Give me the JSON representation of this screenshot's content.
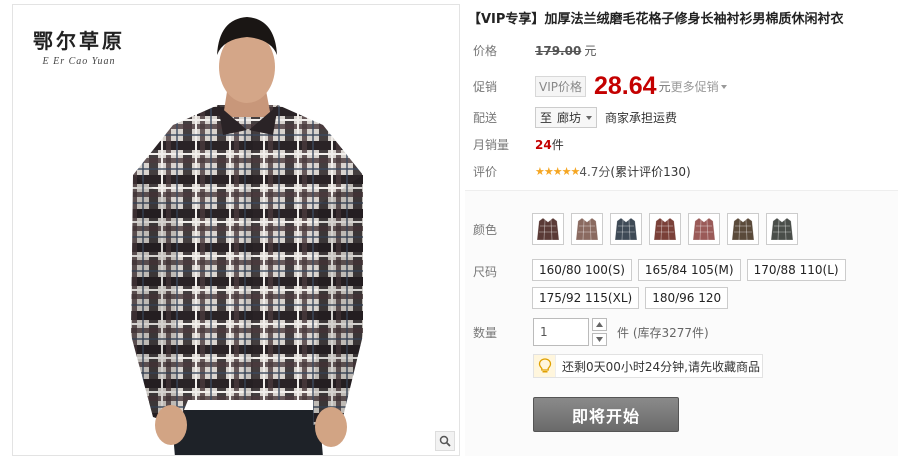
{
  "brand": {
    "name_cn": "鄂尔草原",
    "name_en": "E Er Cao Yuan"
  },
  "product": {
    "title_tag": "【VIP专享】",
    "title": "加厚法兰绒磨毛花格子修身长袖衬衫男棉质休闲衬衣"
  },
  "price": {
    "label": "价格",
    "original": "179.00",
    "unit": "元"
  },
  "promo": {
    "label": "促销",
    "badge": "VIP价格",
    "price": "28.64",
    "unit": "元",
    "more": "更多促销"
  },
  "shipping": {
    "label": "配送",
    "prefix": "至",
    "destination": "廊坊",
    "note": "商家承担运费"
  },
  "sales": {
    "label": "月销量",
    "count": "24",
    "unit": "件"
  },
  "rating": {
    "label": "评价",
    "stars": "★★★★★",
    "score": "4.7分",
    "total": "(累计评价130)"
  },
  "color": {
    "label": "颜色",
    "swatches": [
      {
        "name": "swatch-1",
        "color": "#5a3a36"
      },
      {
        "name": "swatch-2",
        "color": "#8a6a60"
      },
      {
        "name": "swatch-3",
        "color": "#3e4a56"
      },
      {
        "name": "swatch-4",
        "color": "#7a4038"
      },
      {
        "name": "swatch-5",
        "color": "#9a5a58"
      },
      {
        "name": "swatch-6",
        "color": "#5a4a3a"
      },
      {
        "name": "swatch-7",
        "color": "#4a4e4a"
      }
    ]
  },
  "size": {
    "label": "尺码",
    "options": [
      "160/80 100(S)",
      "165/84 105(M)",
      "170/88 110(L)",
      "175/92 115(XL)",
      "180/96 120"
    ]
  },
  "quantity": {
    "label": "数量",
    "value": "1",
    "stock": "件 (库存3277件)"
  },
  "notice": {
    "text": "还剩0天00小时24分钟,请先收藏商品"
  },
  "buy_button": {
    "label": "即将开始"
  }
}
